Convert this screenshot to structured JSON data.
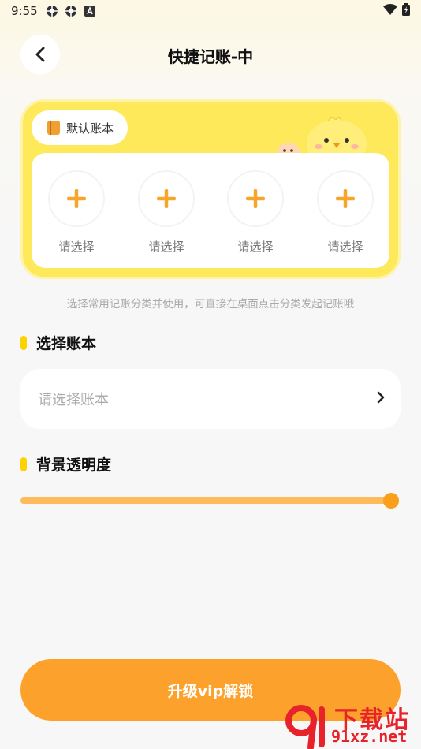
{
  "status_bar": {
    "time": "9:55"
  },
  "header": {
    "title": "快捷记账-中"
  },
  "widget": {
    "book_chip_label": "默认账本",
    "slots": [
      {
        "label": "请选择"
      },
      {
        "label": "请选择"
      },
      {
        "label": "请选择"
      },
      {
        "label": "请选择"
      }
    ]
  },
  "hint": "选择常用记账分类并使用，可直接在桌面点击分类发起记账哦",
  "sections": {
    "select_book": {
      "title": "选择账本",
      "placeholder": "请选择账本"
    },
    "opacity": {
      "title": "背景透明度",
      "value_percent": 100
    }
  },
  "footer": {
    "vip_button_label": "升级vip解锁"
  },
  "watermark": {
    "top": "下载站",
    "bottom": "91xz.net"
  },
  "colors": {
    "accent": "#fca22c",
    "card_yellow": "#fde95a",
    "plus_orange": "#f9a52b",
    "section_mark": "#fcd200"
  }
}
